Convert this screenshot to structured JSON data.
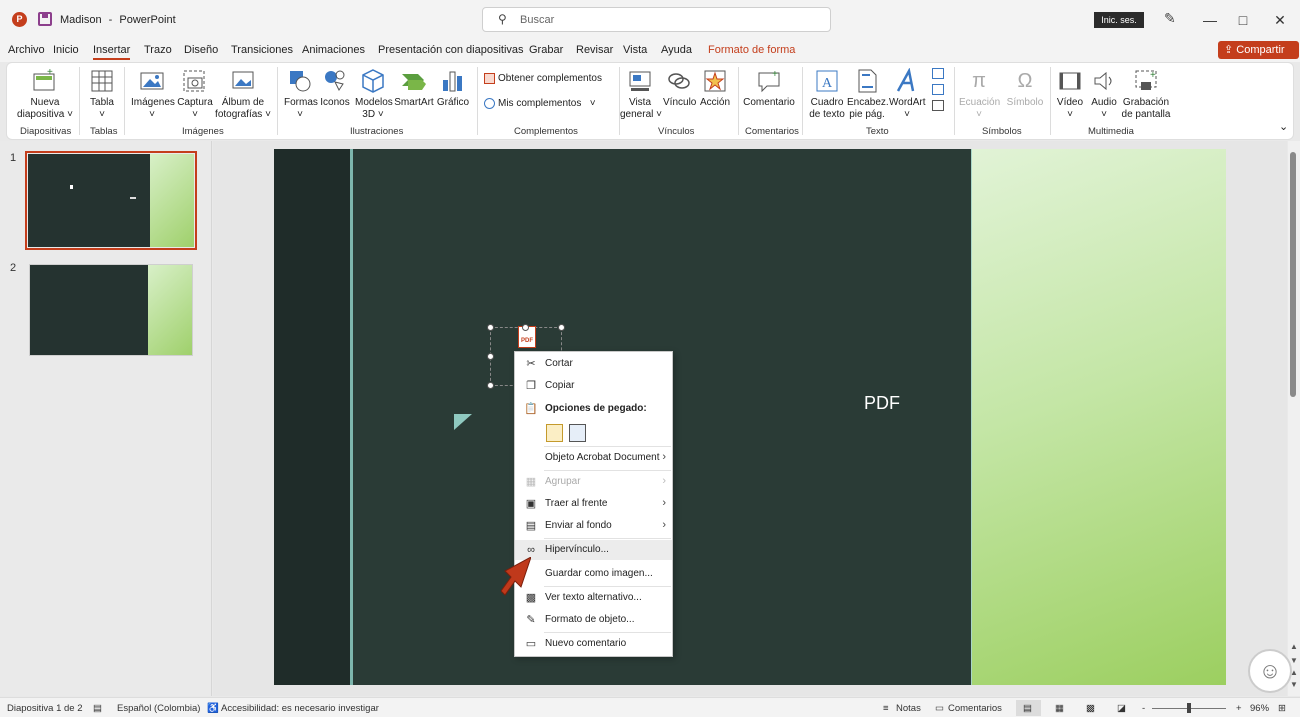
{
  "titlebar": {
    "doc_name": "Madison",
    "app_sep": "-",
    "app_name": "PowerPoint",
    "search_placeholder": "Buscar",
    "signin": "Inic. ses."
  },
  "tabs": [
    "Archivo",
    "Inicio",
    "Insertar",
    "Trazo",
    "Diseño",
    "Transiciones",
    "Animaciones",
    "Presentación con diapositivas",
    "Grabar",
    "Revisar",
    "Vista",
    "Ayuda",
    "Formato de forma"
  ],
  "share_label": "Compartir",
  "ribbon": {
    "nueva_l1": "Nueva",
    "nueva_l2": "diapositiva",
    "tabla": "Tabla",
    "imagenes": "Imágenes",
    "captura": "Captura",
    "album_l1": "Álbum de",
    "album_l2": "fotografías",
    "formas": "Formas",
    "iconos": "Iconos",
    "modelos_l1": "Modelos",
    "modelos_l2": "3D",
    "smartart": "SmartArt",
    "grafico": "Gráfico",
    "obtener": "Obtener complementos",
    "mis": "Mis complementos",
    "vista_l1": "Vista",
    "vista_l2": "general",
    "vinculo": "Vínculo",
    "accion": "Acción",
    "comentario": "Comentario",
    "cuadro_l1": "Cuadro",
    "cuadro_l2": "de texto",
    "encabez_l1": "Encabez.",
    "encabez_l2": "pie pág.",
    "wordart": "WordArt",
    "ecuacion": "Ecuación",
    "simbolo": "Símbolo",
    "video": "Vídeo",
    "audio": "Audio",
    "grab_l1": "Grabación",
    "grab_l2": "de pantalla",
    "groups": {
      "diapositivas": "Diapositivas",
      "tablas": "Tablas",
      "imagenes": "Imágenes",
      "ilustraciones": "Ilustraciones",
      "complementos": "Complementos",
      "vinculos": "Vínculos",
      "comentarios": "Comentarios",
      "texto": "Texto",
      "simbolos": "Símbolos",
      "multimedia": "Multimedia"
    }
  },
  "slides": {
    "n1": "1",
    "n2": "2"
  },
  "slide": {
    "pdf_label": "PDF",
    "pdf_icon_text": "PDF"
  },
  "context_menu": {
    "cortar": "Cortar",
    "copiar": "Copiar",
    "opciones_pegado": "Opciones de pegado:",
    "objeto": "Objeto Acrobat Document",
    "agrupar": "Agrupar",
    "traer": "Traer al frente",
    "enviar": "Enviar al fondo",
    "hipervinculo": "Hipervínculo...",
    "guardar": "Guardar como imagen...",
    "ver_texto": "Ver texto alternativo...",
    "formato": "Formato de objeto...",
    "nuevo_comentario": "Nuevo comentario"
  },
  "status": {
    "diapositiva": "Diapositiva 1 de 2",
    "idioma": "Español (Colombia)",
    "accesibilidad": "Accesibilidad: es necesario investigar",
    "notas": "Notas",
    "comentarios": "Comentarios",
    "zoom": "96%",
    "zoom_level_percent": 96
  },
  "colors": {
    "accent": "#c43e1c",
    "slide_dark": "#2a3b36",
    "slide_green": "#9ccf60"
  }
}
